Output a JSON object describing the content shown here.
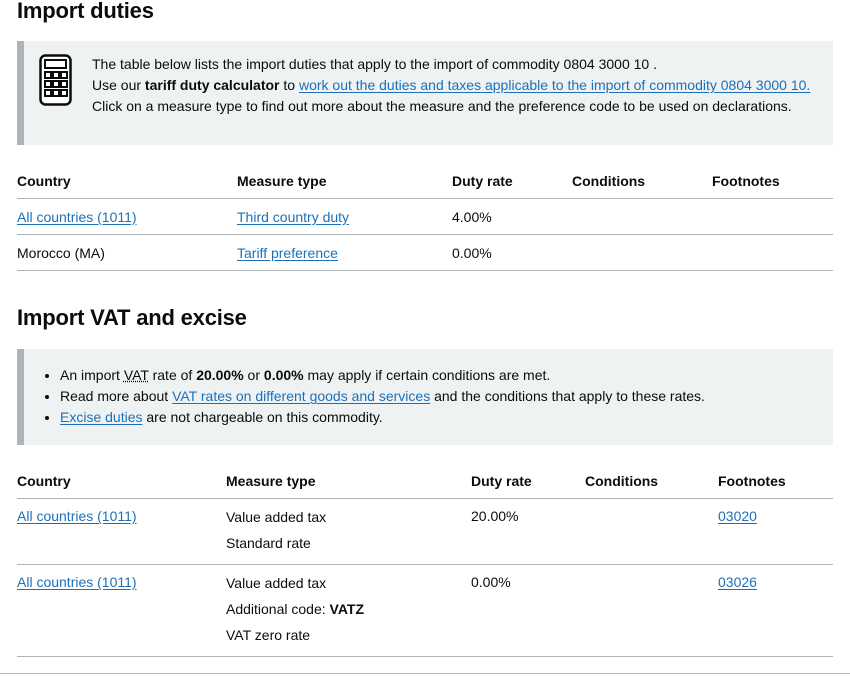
{
  "import_duties": {
    "title": "Import duties",
    "inset": {
      "line1": "The table below lists the import duties that apply to the import of commodity 0804 3000 10 .",
      "line2_prefix": "Use our ",
      "line2_bold": "tariff duty calculator",
      "line2_mid": " to ",
      "line2_link": "work out the duties and taxes applicable to the import of commodity 0804 3000 10.",
      "line3": "Click on a measure type to find out more about the measure and the preference code to be used on declarations."
    },
    "table": {
      "headers": [
        "Country",
        "Measure type",
        "Duty rate",
        "Conditions",
        "Footnotes"
      ],
      "rows": [
        {
          "country": "All countries (1011)",
          "measure": "Third country duty",
          "rate": "4.00%",
          "conditions": "",
          "footnotes": ""
        },
        {
          "country": "Morocco (MA)",
          "measure": "Tariff preference",
          "rate": "0.00%",
          "conditions": "",
          "footnotes": ""
        }
      ]
    }
  },
  "import_vat": {
    "title": "Import VAT and excise",
    "bullets": {
      "b1_a": "An import ",
      "b1_abbr": "VAT",
      "b1_b": " rate of ",
      "b1_rate1": "20.00%",
      "b1_c": " or ",
      "b1_rate2": "0.00%",
      "b1_d": " may apply if certain conditions are met.",
      "b2_a": "Read more about ",
      "b2_link": "VAT rates on different goods and services",
      "b2_b": " and the conditions that apply to these rates.",
      "b3_link": "Excise duties",
      "b3_b": " are not chargeable on this commodity."
    },
    "table": {
      "headers": [
        "Country",
        "Measure type",
        "Duty rate",
        "Conditions",
        "Footnotes"
      ],
      "rows": [
        {
          "country": "All countries (1011)",
          "measure_line1": "Value added tax",
          "measure_line2": "Standard rate",
          "rate": "20.00%",
          "conditions": "",
          "footnote": "03020"
        },
        {
          "country": "All countries (1011)",
          "measure_line1": "Value added tax",
          "additional_code_label": "Additional code: ",
          "additional_code": "VATZ",
          "measure_line3": "VAT zero rate",
          "rate": "0.00%",
          "conditions": "",
          "footnote": "03026"
        }
      ]
    }
  },
  "colors": {
    "link": "#1d70b8",
    "inset_bg": "#eef2f3",
    "inset_border": "#b1b4b6",
    "text": "#0b0c0c"
  },
  "icons": {
    "calculator": "calculator-icon"
  }
}
